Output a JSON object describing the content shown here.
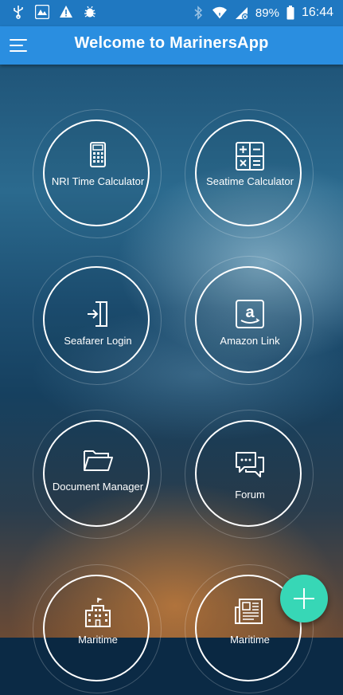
{
  "status_bar": {
    "left_icons": [
      "usb-icon",
      "app-notification-icon",
      "warning-icon",
      "bug-icon"
    ],
    "right_icons": [
      "bluetooth-icon",
      "wifi-icon",
      "no-sim-icon",
      "battery-icon"
    ],
    "battery": "89%",
    "time": "16:44"
  },
  "app_bar": {
    "title": "Welcome to MarinersApp",
    "menu_icon": "hamburger-menu-icon",
    "color": "#2a8ee0"
  },
  "tiles": [
    {
      "label": "NRI Time Calculator",
      "icon": "calculator-icon"
    },
    {
      "label": "Seatime Calculator",
      "icon": "math-operators-icon"
    },
    {
      "label": "Seafarer Login",
      "icon": "login-door-icon"
    },
    {
      "label": "Amazon Link",
      "icon": "amazon-icon"
    },
    {
      "label": "Document Manager",
      "icon": "folder-open-icon"
    },
    {
      "label": "Forum",
      "icon": "chat-bubbles-icon"
    },
    {
      "label": "Maritime",
      "icon": "building-icon"
    },
    {
      "label": "Maritime",
      "icon": "newspaper-icon"
    }
  ],
  "fab": {
    "icon": "plus-icon",
    "color": "#37d7b6"
  }
}
